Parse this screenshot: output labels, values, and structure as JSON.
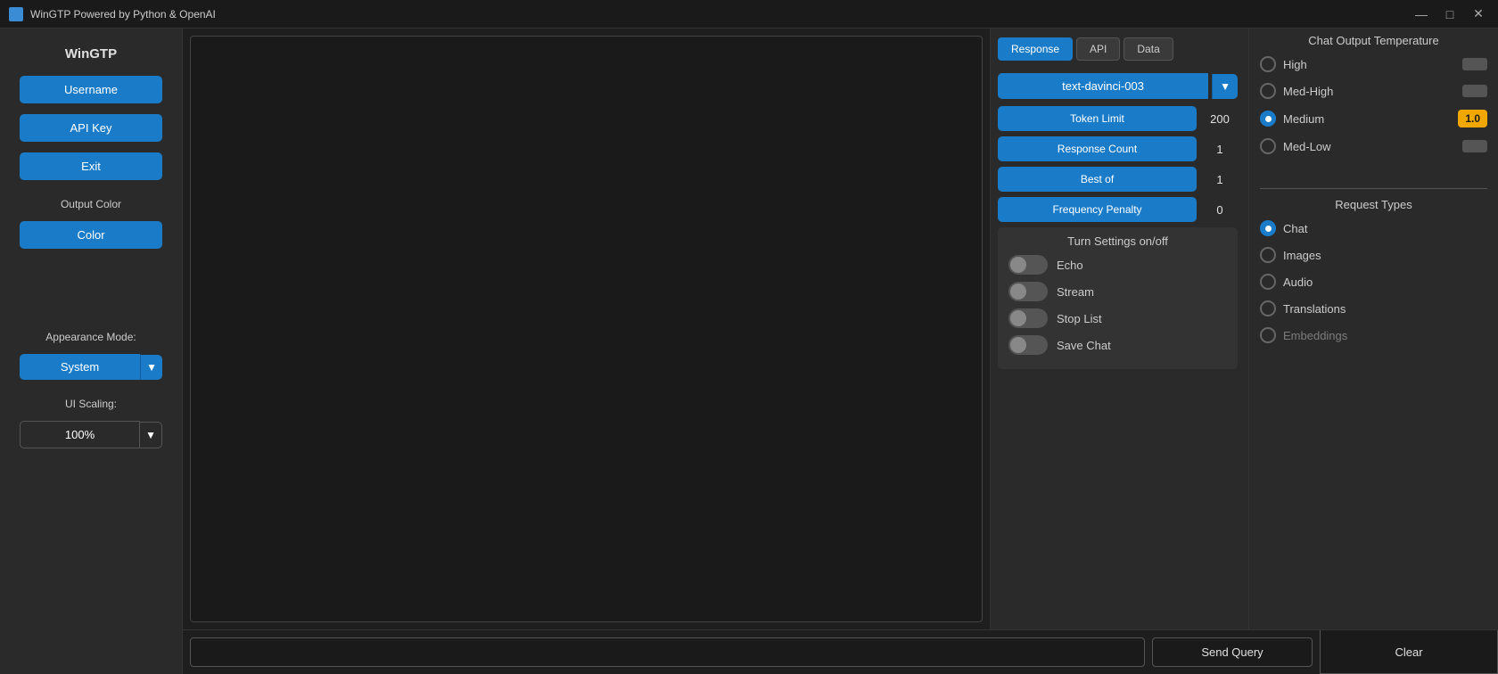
{
  "titlebar": {
    "title": "WinGTP Powered by Python & OpenAI",
    "minimize": "—",
    "maximize": "□",
    "close": "✕"
  },
  "sidebar": {
    "title": "WinGTP",
    "username_btn": "Username",
    "api_key_btn": "API Key",
    "exit_btn": "Exit",
    "output_color_label": "Output Color",
    "color_btn": "Color",
    "appearance_label": "Appearance Mode:",
    "appearance_value": "System",
    "ui_scaling_label": "UI Scaling:",
    "ui_scaling_value": "100%"
  },
  "tabs": [
    {
      "label": "Response",
      "active": true
    },
    {
      "label": "API",
      "active": false
    },
    {
      "label": "Data",
      "active": false
    }
  ],
  "model": {
    "selected": "text-davinci-003"
  },
  "params": [
    {
      "label": "Token Limit",
      "value": "200"
    },
    {
      "label": "Response Count",
      "value": "1"
    },
    {
      "label": "Best of",
      "value": "1"
    },
    {
      "label": "Frequency Penalty",
      "value": "0"
    }
  ],
  "settings_section": {
    "title": "Turn Settings on/off",
    "toggles": [
      {
        "label": "Echo",
        "enabled": false
      },
      {
        "label": "Stream",
        "enabled": false
      },
      {
        "label": "Stop List",
        "enabled": false
      },
      {
        "label": "Save Chat",
        "enabled": false
      }
    ]
  },
  "temperature": {
    "title": "Chat Output Temperature",
    "options": [
      {
        "label": "High",
        "selected": false
      },
      {
        "label": "Med-High",
        "selected": false
      },
      {
        "label": "Medium",
        "selected": true,
        "value": "1.0"
      },
      {
        "label": "Med-Low",
        "selected": false
      }
    ]
  },
  "request_types": {
    "title": "Request Types",
    "options": [
      {
        "label": "Chat",
        "selected": true
      },
      {
        "label": "Images",
        "selected": false
      },
      {
        "label": "Audio",
        "selected": false
      },
      {
        "label": "Translations",
        "selected": false
      },
      {
        "label": "Embeddings",
        "selected": false,
        "partial": true
      }
    ]
  },
  "input": {
    "placeholder": "",
    "send_btn": "Send Query",
    "clear_btn": "Clear"
  }
}
